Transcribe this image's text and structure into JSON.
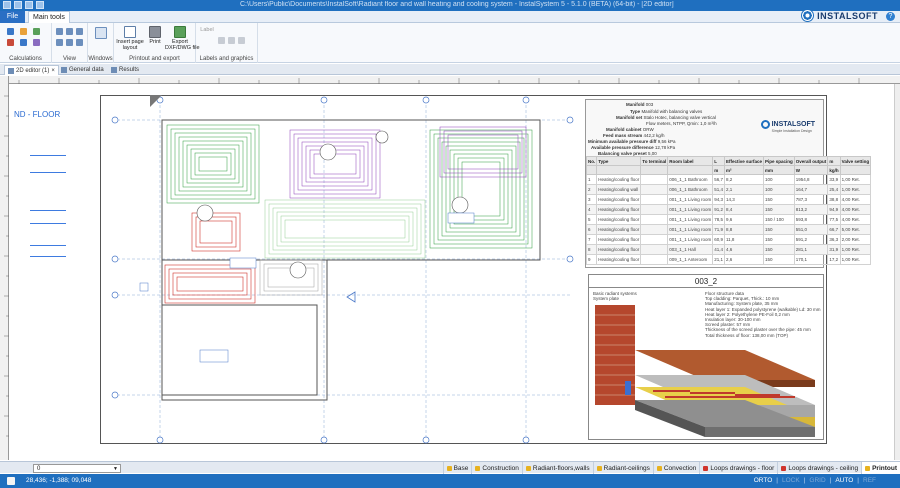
{
  "window": {
    "title": "C:\\Users\\Public\\Documents\\InstalSoft\\Radiant floor and wall heating and cooling system - InstalSystem 5 - 5.1.0 (BETA) (64-bit) - [2D editor]",
    "logo_text": "INSTALSOFT",
    "help_label": "?"
  },
  "ribbon": {
    "file_tab": "File",
    "main_tab": "Main tools",
    "groups": {
      "calculations": "Calculations",
      "view": "View",
      "windows": "Windows",
      "printout": "Printout and export",
      "labels": "Labels and graphics"
    },
    "buttons": {
      "windows": "Windows",
      "insert_page": "Insert page\nlayout",
      "print": "Print",
      "export": "Export\nDXF/DWG file",
      "label": "Label"
    }
  },
  "doc_tabs": [
    "2D editor (1)",
    "General data",
    "Results"
  ],
  "floor_label": "ND - FLOOR",
  "manifold": {
    "name_label": "Manifold",
    "name_value": "003",
    "type_label": "Type",
    "type_value": "Manifold with balancing valves",
    "model_label": "Manifold set",
    "model_value": "Stalo Hotec, balancing valve vertical",
    "spec_value": "Flow meters, NTPP, Qmin: 1,0 m³/h",
    "cabinet_label": "Manifold cabinet",
    "cabinet_value": "ORW",
    "mass_label": "Feed mass stream",
    "mass_value": "442,2 kg/h",
    "min_pressure_label": "Minimum available pressure diff",
    "min_pressure_value": "9,56 kPa",
    "avail_pressure_label": "Available pressure difference",
    "avail_pressure_value": "12,78 kPa",
    "balancing_label": "Balancing valve preset",
    "balancing_value": "5,00",
    "logo_text": "INSTALSOFT",
    "logo_sub": "Simple Installation Design",
    "columns": [
      "No.",
      "Type",
      "To terminal",
      "Room label",
      "L",
      "Effective surface",
      "Pipe spacing",
      "Overall output",
      "m",
      "Valve setting"
    ],
    "units": [
      "",
      "",
      "",
      "",
      "m",
      "m²",
      "mm",
      "W",
      "kg/h",
      ""
    ],
    "rows": [
      [
        "1",
        "Heating/cooling floor",
        "",
        "006_1_1 Bathroom",
        "56,7",
        "8,2",
        "100",
        "1954,8",
        "33,9",
        "1,00 Ret."
      ],
      [
        "2",
        "Heating/cooling wall",
        "",
        "006_1_1 Bathroom",
        "51,4",
        "2,1",
        "100",
        "164,7",
        "25,4",
        "1,00 Ret."
      ],
      [
        "3",
        "Heating/cooling floor",
        "",
        "001_1_1 Living room",
        "94,3",
        "14,3",
        "150",
        "787,3",
        "38,8",
        "4,00 Ret."
      ],
      [
        "4",
        "Heating/cooling floor",
        "",
        "001_1_1 Living room",
        "91,2",
        "8,4",
        "150",
        "813,2",
        "94,9",
        "4,00 Ret."
      ],
      [
        "5",
        "Heating/cooling floor",
        "",
        "001_1_1 Living room",
        "78,5",
        "9,6",
        "150 / 100",
        "593,8",
        "77,5",
        "4,00 Ret."
      ],
      [
        "6",
        "Heating/cooling floor",
        "",
        "001_1_1 Living room",
        "71,9",
        "8,8",
        "150",
        "551,0",
        "66,7",
        "5,00 Ret."
      ],
      [
        "7",
        "Heating/cooling floor",
        "",
        "001_1_1 Living room",
        "60,9",
        "11,8",
        "150",
        "591,2",
        "36,3",
        "2,00 Ret."
      ],
      [
        "8",
        "Heating/cooling floor",
        "",
        "003_1_1 Hall",
        "41,4",
        "4,6",
        "150",
        "281,1",
        "31,9",
        "1,00 Ret."
      ],
      [
        "9",
        "Heating/cooling floor",
        "",
        "009_1_1 Anteroom",
        "21,1",
        "2,6",
        "150",
        "170,1",
        "17,2",
        "1,00 Ret."
      ]
    ]
  },
  "detail": {
    "title": "003_2",
    "left_desc": [
      "Basic radiant systems",
      "System plate"
    ],
    "right_desc": [
      "Floor structure data",
      "",
      "Top cladding: Parquet, Thick.: 10 mm",
      "Manufacturing: System plate, 35 mm",
      "Heat layer 1: Expanded polystyrene (walkable) Ld: 30 mm",
      "Heat layer 2: Polyethylene PE-Foil 0,2 mm",
      "Insulation layer: 30-100 mm",
      "Screed plaster: 57 mm",
      "Thickness of the screed plaster over the pipe: 45 mm",
      "Total thickness of floor: 138,00 mm (TOP)"
    ]
  },
  "bottom": {
    "layer_value": "0",
    "layer_tabs": [
      {
        "label": "Base",
        "color": "#e8b21f"
      },
      {
        "label": "Construction",
        "color": "#e8b21f"
      },
      {
        "label": "Radiant-floors,walls",
        "color": "#e8b21f"
      },
      {
        "label": "Radiant-ceilings",
        "color": "#e8b21f"
      },
      {
        "label": "Convection",
        "color": "#e8b21f"
      },
      {
        "label": "Loops drawings - floor",
        "color": "#d0342c"
      },
      {
        "label": "Loops drawings - ceiling",
        "color": "#d0342c"
      },
      {
        "label": "Printout",
        "color": "#e8b21f"
      }
    ]
  },
  "status": {
    "coords": "28,436; -1,388; 09,048",
    "modes": [
      "ORTO",
      "LOCK",
      "GRID",
      "AUTO",
      "REF"
    ],
    "modes_off": [
      false,
      true,
      true,
      false,
      true
    ]
  }
}
